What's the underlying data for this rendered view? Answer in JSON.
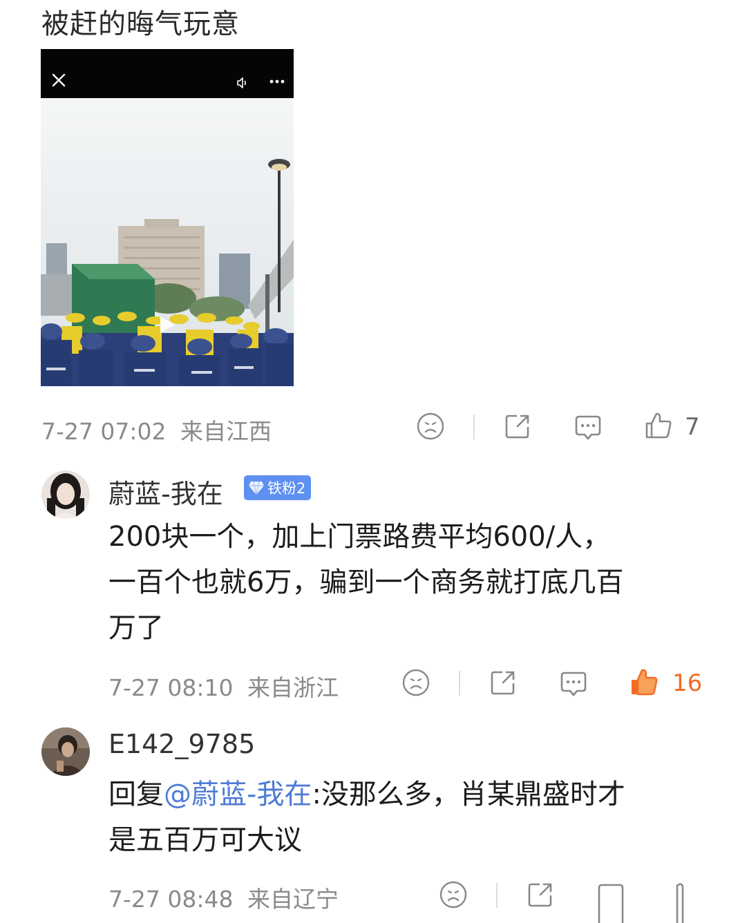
{
  "post": {
    "text": "被赶的晦气玩意",
    "video": {
      "icons": [
        "close-icon",
        "volume-icon",
        "more-icon",
        "play-icon"
      ]
    },
    "time": "7-27 07:02",
    "location": "来自江西",
    "like_count": "7"
  },
  "comments": [
    {
      "username": "蔚蓝-我在",
      "badge": "铁粉2",
      "lines": [
        "200块一个，加上门票路费平均600/人，",
        "一百个也就6万，骗到一个商务就打底几百",
        "万了"
      ],
      "time": "7-27 08:10",
      "location": "来自浙江",
      "like_count": "16",
      "liked": true
    },
    {
      "username": "E142_9785",
      "reply_prefix": "回复",
      "mention": "@蔚蓝-我在",
      "reply_rest": ":没那么多，肖某鼎盛时才",
      "line2": "是五百万可大议",
      "time": "7-27 08:48",
      "location": "来自辽宁"
    }
  ],
  "colors": {
    "accent_like": "#f46b24",
    "mention": "#4d7bd5",
    "badge": "#5e90f2",
    "meta": "#8a8a8a"
  }
}
